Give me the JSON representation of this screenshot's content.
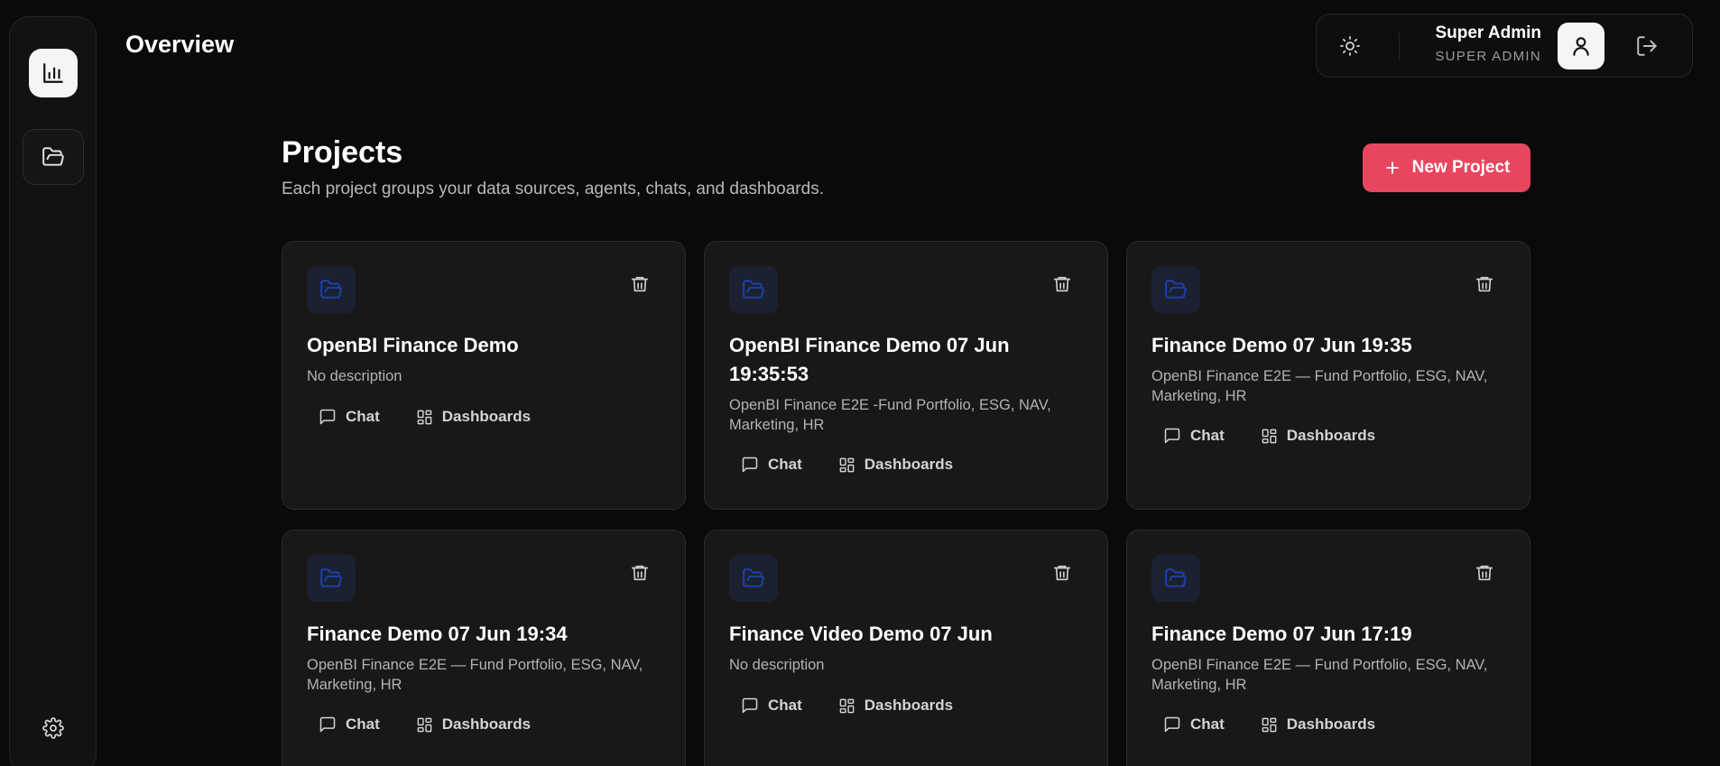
{
  "header": {
    "title": "Overview"
  },
  "user": {
    "name": "Super Admin",
    "role": "SUPER ADMIN"
  },
  "projects": {
    "title": "Projects",
    "subtitle": "Each project groups your data sources, agents, chats, and dashboards.",
    "new_button_label": "New Project",
    "cards": [
      {
        "title": "OpenBI Finance Demo",
        "description": "No description",
        "chat_label": "Chat",
        "dashboards_label": "Dashboards"
      },
      {
        "title": "OpenBI Finance Demo 07 Jun 19:35:53",
        "description": "OpenBI Finance E2E -Fund Portfolio, ESG, NAV, Marketing, HR",
        "chat_label": "Chat",
        "dashboards_label": "Dashboards"
      },
      {
        "title": "Finance Demo 07 Jun 19:35",
        "description": "OpenBI Finance E2E — Fund Portfolio, ESG, NAV, Marketing, HR",
        "chat_label": "Chat",
        "dashboards_label": "Dashboards"
      },
      {
        "title": "Finance Demo 07 Jun 19:34",
        "description": "OpenBI Finance E2E — Fund Portfolio, ESG, NAV, Marketing, HR",
        "chat_label": "Chat",
        "dashboards_label": "Dashboards"
      },
      {
        "title": "Finance Video Demo 07 Jun",
        "description": "No description",
        "chat_label": "Chat",
        "dashboards_label": "Dashboards"
      },
      {
        "title": "Finance Demo 07 Jun 17:19",
        "description": "OpenBI Finance E2E — Fund Portfolio, ESG, NAV, Marketing, HR",
        "chat_label": "Chat",
        "dashboards_label": "Dashboards"
      }
    ]
  },
  "icons": {
    "sidebar_overview": "bar-chart-icon",
    "sidebar_projects": "folder-open-icon",
    "sidebar_settings": "gear-icon",
    "theme": "sun-icon",
    "avatar": "user-icon",
    "logout": "logout-icon",
    "card": "folder-open-icon",
    "delete": "trash-icon",
    "chat": "message-square-icon",
    "dashboards": "layout-grid-icon",
    "new": "plus-icon"
  },
  "colors": {
    "background": "#0a0a0a",
    "card": "#181818",
    "accent": "#e8465f",
    "folder_icon": "#1e40af"
  }
}
